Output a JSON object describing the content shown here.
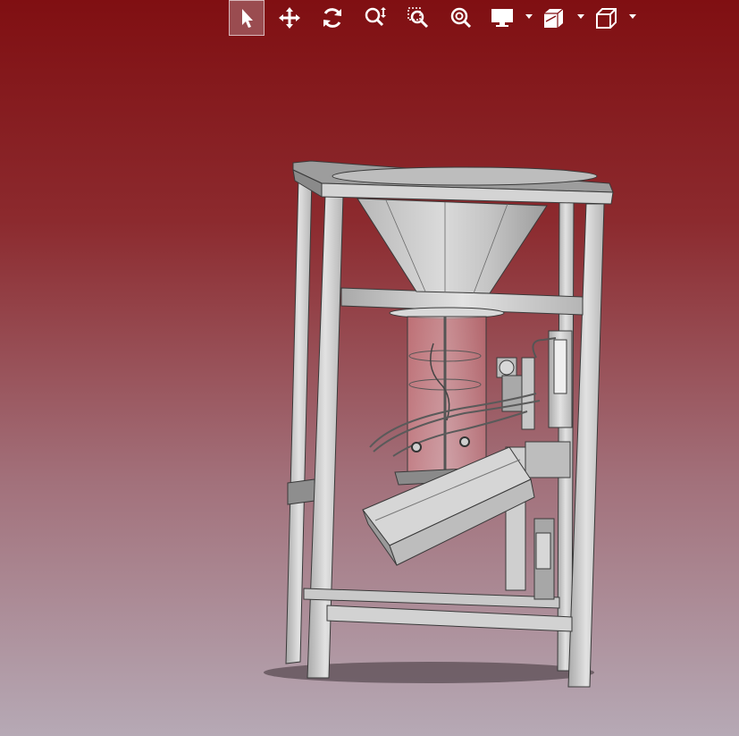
{
  "viewer": {
    "background_top": "#800f12",
    "background_bottom": "#b6a9b5",
    "model_name": "",
    "model_color": "#cfcfcf",
    "edge_color": "#3a3a3a",
    "cylinder_tint": "#e8b5b8"
  },
  "toolbar": {
    "items": [
      {
        "name": "select-tool",
        "icon": "arrow-pointer-icon",
        "active": true
      },
      {
        "name": "pan-tool",
        "icon": "move-arrows-icon",
        "active": false
      },
      {
        "name": "rotate-tool",
        "icon": "rotate-icon",
        "active": false
      },
      {
        "name": "zoom-tool",
        "icon": "zoom-vertical-icon",
        "active": false
      },
      {
        "name": "zoom-window-tool",
        "icon": "zoom-window-icon",
        "active": false
      },
      {
        "name": "zoom-fit-tool",
        "icon": "zoom-fit-icon",
        "active": false
      },
      {
        "name": "display-mode-menu",
        "icon": "monitor-icon",
        "has_dropdown": true
      },
      {
        "name": "section-menu",
        "icon": "section-cube-icon",
        "has_dropdown": true
      },
      {
        "name": "view-orientation-menu",
        "icon": "cube-wireframe-icon",
        "has_dropdown": true
      }
    ]
  }
}
